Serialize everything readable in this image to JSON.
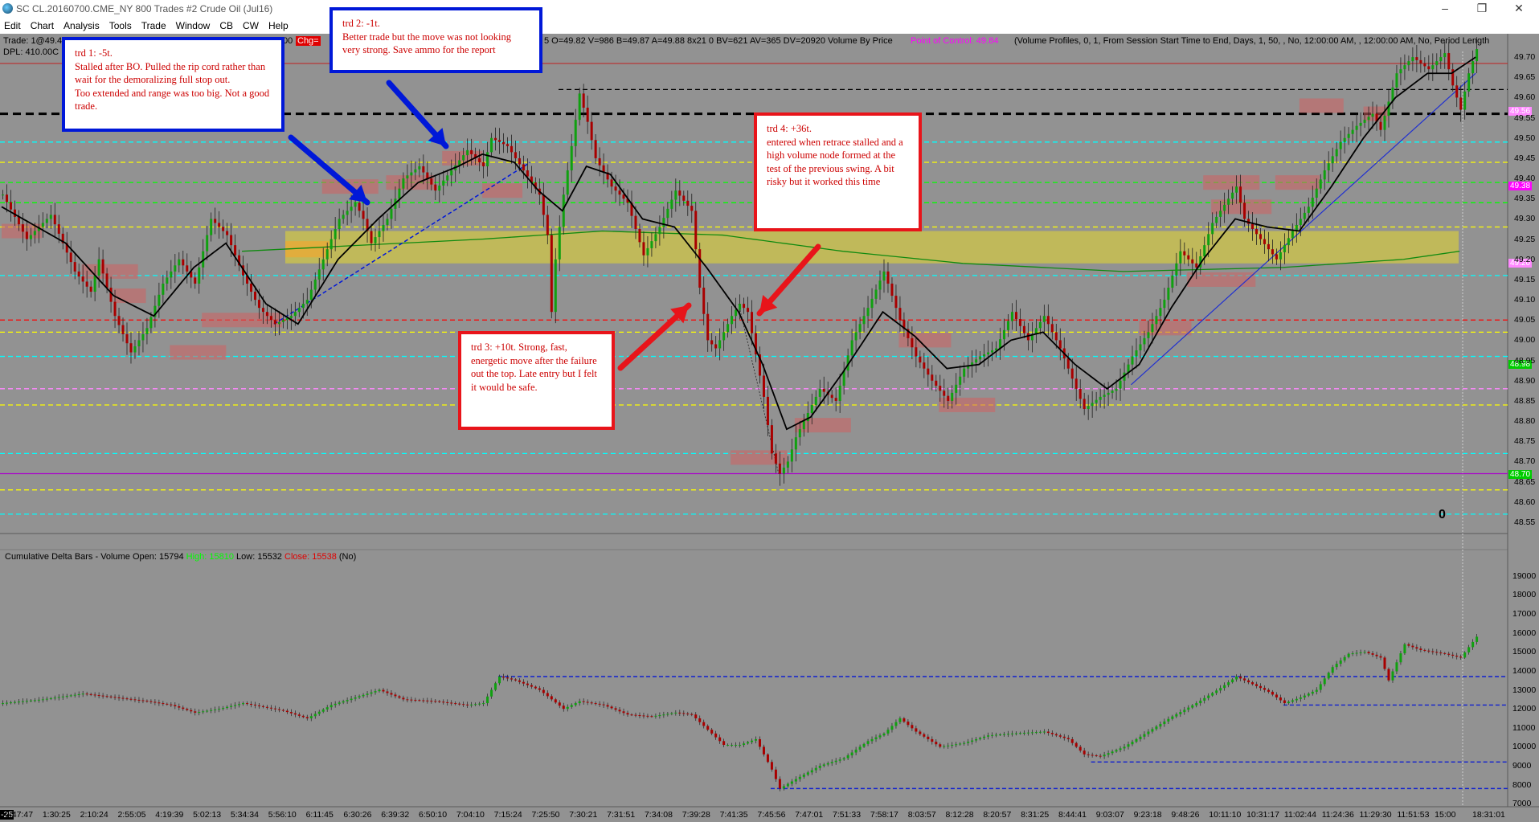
{
  "window": {
    "title": "SC CL.20160700.CME_NY  800 Trades  #2  Crude Oil (Jul16)",
    "controls": [
      "–",
      "❐",
      "✕"
    ]
  },
  "menu": [
    "Edit",
    "Chart",
    "Analysis",
    "Tools",
    "Trade",
    "Window",
    "CB",
    "CW",
    "Help"
  ],
  "header": {
    "trade": "Trade: 1@49.4",
    "dpl": "DPL: 410.00C",
    "chg_prefix": "00",
    "chg": "Chg=",
    "ohlc": "5 O=49.82 V=986 B=49.87 A=49.88 8x21 0 BV=621 AV=365 DV=20920 Volume By Price",
    "poc": "Point of Control: 49.84",
    "profile": "(Volume Profiles, 0, 1, From Session Start Time to End, Days, 1, 50, , No, 12:00:00 AM, , 12:00:00 AM, No, Period Length"
  },
  "annotations": [
    {
      "id": "trd1",
      "lines": [
        "trd 1: -5t.",
        "Stalled after BO.  Pulled the rip cord rather than wait for the demoralizing full stop out.",
        "Too extended and range was too big.  Not a good trade."
      ]
    },
    {
      "id": "trd2",
      "lines": [
        "trd 2: -1t.",
        "Better trade but the move was not looking very strong. Save ammo for the report"
      ]
    },
    {
      "id": "trd3",
      "lines": [
        "trd 3: +10t.  Strong, fast, energetic move after the failure out the top.  Late entry but I felt it would be safe."
      ]
    },
    {
      "id": "trd4",
      "lines": [
        "trd 4: +36t.",
        "entered when retrace stalled and a high volume node formed at the test of the previous swing.  A bit risky but it worked this time"
      ]
    }
  ],
  "position_label": "0",
  "price_tags": [
    "49.56",
    "49.38",
    "49.20",
    "48.98",
    "48.70"
  ],
  "lower_header": {
    "title": "Cumulative Delta Bars - Volume",
    "open": "Open: 15794",
    "high": "High: 15810",
    "low": "Low: 15532",
    "close": "Close: 15538",
    "flag": "(No)"
  },
  "time_axis_start": "-25",
  "colors": {
    "background": "#929292",
    "up_candle": "#10a010",
    "down_candle": "#b00000",
    "ma": "#000000",
    "vwap": "#109010",
    "value_area": "#c8c050",
    "annotation_blue": "#0018d8",
    "annotation_red": "#e8141a",
    "poc": "#ff00ff"
  },
  "chart_data": [
    {
      "type": "candlestick",
      "title": "Crude Oil (Jul16) 800 Trades",
      "y_ticks": [
        "49.70",
        "49.65",
        "49.60",
        "49.55",
        "49.50",
        "49.45",
        "49.40",
        "49.35",
        "49.30",
        "49.25",
        "49.20",
        "49.15",
        "49.10",
        "49.05",
        "49.00",
        "48.95",
        "48.90",
        "48.85",
        "48.80",
        "48.75",
        "48.70",
        "48.65",
        "48.60",
        "48.55"
      ],
      "ylim": [
        48.53,
        49.73
      ],
      "x_ticks": [
        "0:47:47",
        "1:30:25",
        "2:10:24",
        "2:55:05",
        "4:19:39",
        "5:02:13",
        "5:34:34",
        "5:56:10",
        "6:11:45",
        "6:30:26",
        "6:39:32",
        "6:50:10",
        "7:04:10",
        "7:15:24",
        "7:25:50",
        "7:30:21",
        "7:31:51",
        "7:34:08",
        "7:39:28",
        "7:41:35",
        "7:45:56",
        "7:47:01",
        "7:51:33",
        "7:58:17",
        "8:03:57",
        "8:12:28",
        "8:20:57",
        "8:31:25",
        "8:44:41",
        "9:03:07",
        "9:23:18",
        "9:48:26",
        "10:11:10",
        "10:31:17",
        "11:02:44",
        "11:24:36",
        "11:29:30",
        "11:51:53",
        "15:00",
        "18:31:01"
      ],
      "price_path": [
        [
          0,
          49.36
        ],
        [
          3,
          49.25
        ],
        [
          6,
          49.31
        ],
        [
          9,
          49.17
        ],
        [
          11,
          49.12
        ],
        [
          12,
          49.2
        ],
        [
          14,
          49.06
        ],
        [
          16,
          48.97
        ],
        [
          18,
          49.03
        ],
        [
          20,
          49.14
        ],
        [
          22,
          49.2
        ],
        [
          24,
          49.14
        ],
        [
          26,
          49.3
        ],
        [
          28,
          49.26
        ],
        [
          30,
          49.16
        ],
        [
          32,
          49.08
        ],
        [
          34,
          49.04
        ],
        [
          36,
          49.06
        ],
        [
          38,
          49.1
        ],
        [
          40,
          49.2
        ],
        [
          42,
          49.3
        ],
        [
          44,
          49.34
        ],
        [
          45,
          49.3
        ],
        [
          46,
          49.24
        ],
        [
          48,
          49.3
        ],
        [
          50,
          49.4
        ],
        [
          52,
          49.43
        ],
        [
          54,
          49.37
        ],
        [
          56,
          49.42
        ],
        [
          58,
          49.47
        ],
        [
          60,
          49.43
        ],
        [
          61,
          49.5
        ],
        [
          63,
          49.48
        ],
        [
          65,
          49.42
        ],
        [
          67,
          49.36
        ],
        [
          68,
          49.26
        ],
        [
          68.5,
          49.07
        ],
        [
          69,
          49.2
        ],
        [
          70,
          49.36
        ],
        [
          71,
          49.48
        ],
        [
          72,
          49.61
        ],
        [
          73,
          49.54
        ],
        [
          74,
          49.45
        ],
        [
          76,
          49.38
        ],
        [
          78,
          49.34
        ],
        [
          80,
          49.21
        ],
        [
          82,
          49.28
        ],
        [
          84,
          49.37
        ],
        [
          86,
          49.32
        ],
        [
          87,
          49.13
        ],
        [
          88,
          49.0
        ],
        [
          89,
          48.98
        ],
        [
          91,
          49.06
        ],
        [
          92,
          49.09
        ],
        [
          93,
          49.07
        ],
        [
          95,
          48.86
        ],
        [
          96,
          48.72
        ],
        [
          97,
          48.67
        ],
        [
          98,
          48.7
        ],
        [
          99,
          48.76
        ],
        [
          100,
          48.8
        ],
        [
          102,
          48.88
        ],
        [
          104,
          48.85
        ],
        [
          106,
          49.0
        ],
        [
          108,
          49.08
        ],
        [
          110,
          49.17
        ],
        [
          112,
          49.05
        ],
        [
          114,
          48.96
        ],
        [
          116,
          48.9
        ],
        [
          118,
          48.85
        ],
        [
          120,
          48.93
        ],
        [
          122,
          48.96
        ],
        [
          124,
          48.98
        ],
        [
          126,
          49.07
        ],
        [
          128,
          49.0
        ],
        [
          130,
          49.06
        ],
        [
          132,
          48.98
        ],
        [
          134,
          48.88
        ],
        [
          135,
          48.83
        ],
        [
          137,
          48.86
        ],
        [
          139,
          48.88
        ],
        [
          141,
          48.96
        ],
        [
          143,
          49.02
        ],
        [
          145,
          49.1
        ],
        [
          147,
          49.22
        ],
        [
          149,
          49.18
        ],
        [
          151,
          49.29
        ],
        [
          153,
          49.35
        ],
        [
          154,
          49.38
        ],
        [
          155,
          49.3
        ],
        [
          157,
          49.25
        ],
        [
          159,
          49.2
        ],
        [
          161,
          49.27
        ],
        [
          163,
          49.33
        ],
        [
          165,
          49.42
        ],
        [
          167,
          49.49
        ],
        [
          169,
          49.53
        ],
        [
          171,
          49.56
        ],
        [
          172,
          49.52
        ],
        [
          174,
          49.66
        ],
        [
          176,
          49.7
        ],
        [
          178,
          49.67
        ],
        [
          179,
          49.69
        ],
        [
          180,
          49.71
        ],
        [
          181,
          49.63
        ],
        [
          182,
          49.57
        ],
        [
          183,
          49.66
        ],
        [
          184,
          49.72
        ]
      ],
      "moving_average": [
        [
          0,
          49.33
        ],
        [
          8,
          49.24
        ],
        [
          14,
          49.11
        ],
        [
          19,
          49.06
        ],
        [
          24,
          49.18
        ],
        [
          28,
          49.24
        ],
        [
          33,
          49.09
        ],
        [
          37,
          49.04
        ],
        [
          42,
          49.2
        ],
        [
          47,
          49.3
        ],
        [
          52,
          49.39
        ],
        [
          57,
          49.43
        ],
        [
          60,
          49.46
        ],
        [
          64,
          49.44
        ],
        [
          67,
          49.37
        ],
        [
          70,
          49.32
        ],
        [
          73,
          49.43
        ],
        [
          76,
          49.41
        ],
        [
          80,
          49.3
        ],
        [
          84,
          49.28
        ],
        [
          88,
          49.18
        ],
        [
          92,
          49.07
        ],
        [
          95,
          48.94
        ],
        [
          98,
          48.78
        ],
        [
          101,
          48.81
        ],
        [
          105,
          48.92
        ],
        [
          110,
          49.07
        ],
        [
          114,
          49.01
        ],
        [
          118,
          48.93
        ],
        [
          122,
          48.94
        ],
        [
          126,
          49.0
        ],
        [
          130,
          49.02
        ],
        [
          134,
          48.94
        ],
        [
          138,
          48.88
        ],
        [
          142,
          48.94
        ],
        [
          146,
          49.08
        ],
        [
          150,
          49.2
        ],
        [
          154,
          49.3
        ],
        [
          158,
          49.28
        ],
        [
          162,
          49.27
        ],
        [
          166,
          49.38
        ],
        [
          170,
          49.5
        ],
        [
          174,
          49.6
        ],
        [
          178,
          49.66
        ],
        [
          181,
          49.66
        ],
        [
          184,
          49.7
        ]
      ],
      "vwap": [
        [
          30,
          49.22
        ],
        [
          60,
          49.25
        ],
        [
          75,
          49.27
        ],
        [
          90,
          49.26
        ],
        [
          105,
          49.22
        ],
        [
          120,
          49.19
        ],
        [
          140,
          49.17
        ],
        [
          160,
          49.18
        ],
        [
          175,
          49.2
        ],
        [
          182,
          49.22
        ]
      ],
      "value_area": {
        "low": 49.19,
        "high": 49.27
      },
      "point_of_control": 49.84,
      "reference_lines": [
        {
          "price": 49.56,
          "color": "#000000",
          "style": "dashed-bold"
        },
        {
          "price": 49.62,
          "color": "#000000",
          "style": "dashed"
        },
        {
          "price": 49.49,
          "color": "#00ffff",
          "style": "dashed"
        },
        {
          "price": 49.44,
          "color": "#ffff00",
          "style": "dashed"
        },
        {
          "price": 49.39,
          "color": "#00ff00",
          "style": "dashed"
        },
        {
          "price": 49.34,
          "color": "#00ff00",
          "style": "dashed"
        },
        {
          "price": 49.28,
          "color": "#ffff00",
          "style": "dashed"
        },
        {
          "price": 49.16,
          "color": "#00ffff",
          "style": "dashed"
        },
        {
          "price": 49.05,
          "color": "#ff0000",
          "style": "dashed"
        },
        {
          "price": 49.02,
          "color": "#ffff00",
          "style": "dashed"
        },
        {
          "price": 48.96,
          "color": "#00ffff",
          "style": "dashed"
        },
        {
          "price": 48.88,
          "color": "#ff88ff",
          "style": "dashed"
        },
        {
          "price": 48.84,
          "color": "#ffff00",
          "style": "dashed"
        },
        {
          "price": 48.72,
          "color": "#00ffff",
          "style": "dashed"
        },
        {
          "price": 48.67,
          "color": "#aa00cc",
          "style": "solid"
        },
        {
          "price": 48.63,
          "color": "#ffff00",
          "style": "dashed"
        },
        {
          "price": 48.57,
          "color": "#00ffff",
          "style": "dashed"
        }
      ]
    },
    {
      "type": "bar",
      "title": "Cumulative Delta Bars - Volume",
      "y_ticks": [
        "19000",
        "18000",
        "17000",
        "16000",
        "15000",
        "14000",
        "13000",
        "12000",
        "11000",
        "10000",
        "9000",
        "8000",
        "7000"
      ],
      "ylim": [
        6800,
        19500
      ],
      "delta_path": [
        [
          0,
          12300
        ],
        [
          5,
          12500
        ],
        [
          10,
          12800
        ],
        [
          14,
          12600
        ],
        [
          18,
          12400
        ],
        [
          21,
          12200
        ],
        [
          24,
          11800
        ],
        [
          27,
          12000
        ],
        [
          30,
          12300
        ],
        [
          35,
          11900
        ],
        [
          38,
          11500
        ],
        [
          41,
          12200
        ],
        [
          44,
          12600
        ],
        [
          47,
          13000
        ],
        [
          50,
          12500
        ],
        [
          54,
          12400
        ],
        [
          58,
          12200
        ],
        [
          60,
          12300
        ],
        [
          62,
          13700
        ],
        [
          64,
          13500
        ],
        [
          67,
          13000
        ],
        [
          70,
          12000
        ],
        [
          72,
          12400
        ],
        [
          75,
          12200
        ],
        [
          78,
          11700
        ],
        [
          81,
          11600
        ],
        [
          84,
          11800
        ],
        [
          86,
          11700
        ],
        [
          88,
          10900
        ],
        [
          90,
          10100
        ],
        [
          92,
          10100
        ],
        [
          94,
          10400
        ],
        [
          96,
          8800
        ],
        [
          97,
          7800
        ],
        [
          99,
          8300
        ],
        [
          102,
          9000
        ],
        [
          105,
          9400
        ],
        [
          108,
          10300
        ],
        [
          110,
          10700
        ],
        [
          112,
          11500
        ],
        [
          114,
          10800
        ],
        [
          117,
          10000
        ],
        [
          120,
          10200
        ],
        [
          123,
          10600
        ],
        [
          126,
          10700
        ],
        [
          130,
          10800
        ],
        [
          133,
          10400
        ],
        [
          135,
          9600
        ],
        [
          137,
          9500
        ],
        [
          140,
          10000
        ],
        [
          143,
          10800
        ],
        [
          146,
          11600
        ],
        [
          149,
          12300
        ],
        [
          152,
          13100
        ],
        [
          154,
          13700
        ],
        [
          156,
          13300
        ],
        [
          158,
          12900
        ],
        [
          160,
          12300
        ],
        [
          162,
          12600
        ],
        [
          164,
          13000
        ],
        [
          166,
          14200
        ],
        [
          168,
          14900
        ],
        [
          170,
          15000
        ],
        [
          172,
          14700
        ],
        [
          173,
          13500
        ],
        [
          175,
          15400
        ],
        [
          177,
          15100
        ],
        [
          180,
          14900
        ],
        [
          182,
          14700
        ],
        [
          184,
          15800
        ]
      ],
      "reference_lines": [
        {
          "value": 13700,
          "from_bar": 62,
          "to_bar": 188
        },
        {
          "value": 12200,
          "from_bar": 160,
          "to_bar": 188
        },
        {
          "value": 9200,
          "from_bar": 136,
          "to_bar": 188
        },
        {
          "value": 7800,
          "from_bar": 96,
          "to_bar": 188
        }
      ]
    }
  ]
}
